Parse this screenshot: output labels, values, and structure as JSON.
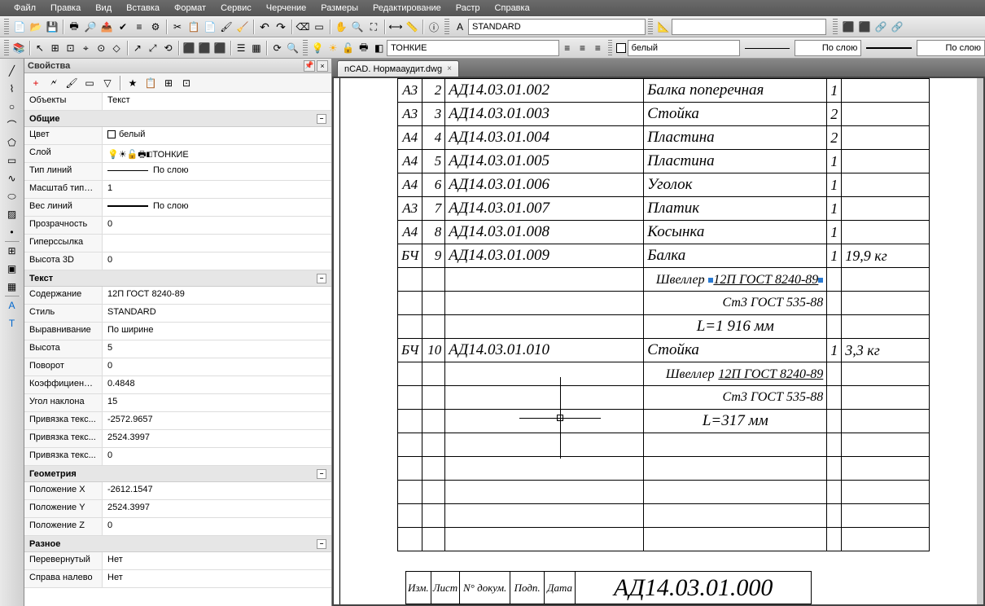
{
  "menu": [
    "Файл",
    "Правка",
    "Вид",
    "Вставка",
    "Формат",
    "Сервис",
    "Черчение",
    "Размеры",
    "Редактирование",
    "Растр",
    "Справка"
  ],
  "toolbars": {
    "style_input": "STANDARD",
    "layer": "ТОНКИЕ",
    "color": "белый",
    "bylayer1": "По слою",
    "bylayer2": "По слою"
  },
  "panel": {
    "title": "Свойства",
    "object_type_label": "Объекты",
    "object_type": "Текст",
    "groups": {
      "general": "Общие",
      "text": "Текст",
      "geometry": "Геометрия",
      "misc": "Разное"
    },
    "props": {
      "color_l": "Цвет",
      "color_v": "белый",
      "layer_l": "Слой",
      "layer_v": "ТОНКИЕ",
      "ltype_l": "Тип линий",
      "ltype_v": "По слою",
      "ltscale_l": "Масштаб типа ...",
      "ltscale_v": "1",
      "lweight_l": "Вес линий",
      "lweight_v": "По слою",
      "transp_l": "Прозрачность",
      "transp_v": "0",
      "hyper_l": "Гиперссылка",
      "hyper_v": "",
      "h3d_l": "Высота 3D",
      "h3d_v": "0",
      "content_l": "Содержание",
      "content_v": "12П  ГОСТ 8240-89",
      "style_l": "Стиль",
      "style_v": "STANDARD",
      "align_l": "Выравнивание",
      "align_v": "По ширине",
      "height_l": "Высота",
      "height_v": "5",
      "rot_l": "Поворот",
      "rot_v": "0",
      "coef_l": "Коэффициент ...",
      "coef_v": "0.4848",
      "obl_l": "Угол наклона",
      "obl_v": "15",
      "bindx_l": "Привязка текс...",
      "bindx_v": "-2572.9657",
      "bindy_l": "Привязка текс...",
      "bindy_v": "2524.3997",
      "bindz_l": "Привязка текс...",
      "bindz_v": "0",
      "posx_l": "Положение X",
      "posx_v": "-2612.1547",
      "posy_l": "Положение Y",
      "posy_v": "2524.3997",
      "posz_l": "Положение Z",
      "posz_v": "0",
      "upside_l": "Перевернутый",
      "upside_v": "Нет",
      "rtl_l": "Справа налево",
      "rtl_v": "Нет"
    }
  },
  "doc_tab": "nCAD. Нормааудит.dwg",
  "spec_rows": [
    {
      "fmt": "А3",
      "pos": "2",
      "code": "АД14.03.01.002",
      "name": "Балка поперечная",
      "qty": "1",
      "note": ""
    },
    {
      "fmt": "А3",
      "pos": "3",
      "code": "АД14.03.01.003",
      "name": "Стойка",
      "qty": "2",
      "note": ""
    },
    {
      "fmt": "А4",
      "pos": "4",
      "code": "АД14.03.01.004",
      "name": "Пластина",
      "qty": "2",
      "note": ""
    },
    {
      "fmt": "А4",
      "pos": "5",
      "code": "АД14.03.01.005",
      "name": "Пластина",
      "qty": "1",
      "note": ""
    },
    {
      "fmt": "А4",
      "pos": "6",
      "code": "АД14.03.01.006",
      "name": "Уголок",
      "qty": "1",
      "note": ""
    },
    {
      "fmt": "А3",
      "pos": "7",
      "code": "АД14.03.01.007",
      "name": "Платик",
      "qty": "1",
      "note": ""
    },
    {
      "fmt": "А4",
      "pos": "8",
      "code": "АД14.03.01.008",
      "name": "Косынка",
      "qty": "1",
      "note": ""
    },
    {
      "fmt": "БЧ",
      "pos": "9",
      "code": "АД14.03.01.009",
      "name": "Балка",
      "qty": "1",
      "note": "19,9 кг"
    }
  ],
  "spec_detail1": {
    "mat_label": "Швеллер",
    "gost1": "12П  ГОСТ 8240-89",
    "gost2": "Ст3 ГОСТ 535-88",
    "len": "L=1 916  мм"
  },
  "spec_row10": {
    "fmt": "БЧ",
    "pos": "10",
    "code": "АД14.03.01.010",
    "name": "Стойка",
    "qty": "1",
    "note": "3,3 кг"
  },
  "spec_detail2": {
    "mat_label": "Швеллер",
    "gost1": "12П  ГОСТ 8240-89",
    "gost2": "Ст3 ГОСТ 535-88",
    "len": "L=317  мм"
  },
  "title_block": {
    "main": "АД14.03.01.000",
    "cols": [
      "Изм.",
      "Лист",
      "N° докум.",
      "Подп.",
      "Дата"
    ]
  }
}
